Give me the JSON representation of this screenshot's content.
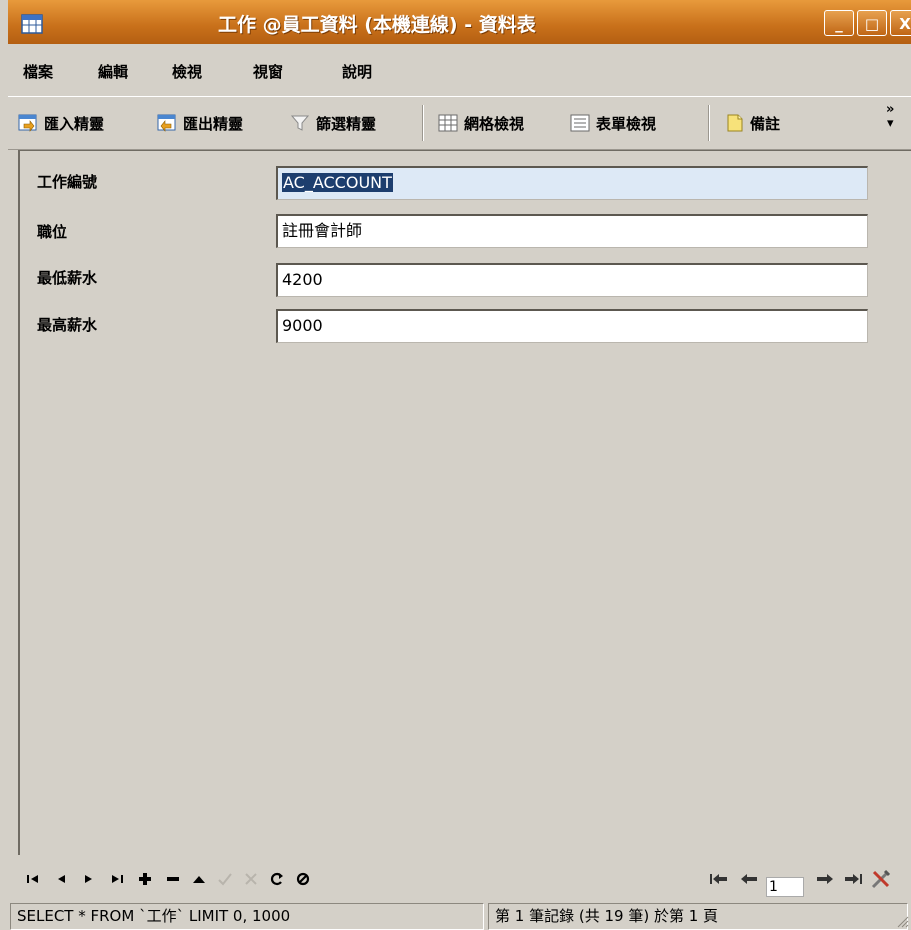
{
  "window": {
    "title": "工作 @員工資料 (本機連線) - 資料表",
    "buttons": {
      "minimize": "_",
      "maximize": "□",
      "close": "X"
    },
    "title_bar_color": "#c8701a"
  },
  "menu": [
    "檔案",
    "編輯",
    "檢視",
    "視窗",
    "說明"
  ],
  "toolbar": {
    "import_wizard": "匯入精靈",
    "export_wizard": "匯出精靈",
    "filter_wizard": "篩選精靈",
    "grid_view": "網格檢視",
    "form_view": "表單檢視",
    "memo": "備註",
    "more": "»"
  },
  "form": {
    "fields": [
      {
        "label": "工作編號",
        "value": "AC_ACCOUNT"
      },
      {
        "label": "職位",
        "value": "註冊會計師"
      },
      {
        "label": "最低薪水",
        "value": "4200"
      },
      {
        "label": "最高薪水",
        "value": "9000"
      }
    ]
  },
  "navigation": {
    "buttons": [
      "first-record",
      "previous-record",
      "next-record",
      "last-record",
      "insert-record",
      "delete-record",
      "edit-record",
      "post-edit",
      "cancel-edit",
      "refresh",
      "stop"
    ],
    "page_number": "1"
  },
  "status": {
    "query": "SELECT * FROM `工作` LIMIT 0, 1000",
    "record_info": "第 1 筆記錄 (共 19 筆) 於第 1 頁"
  }
}
